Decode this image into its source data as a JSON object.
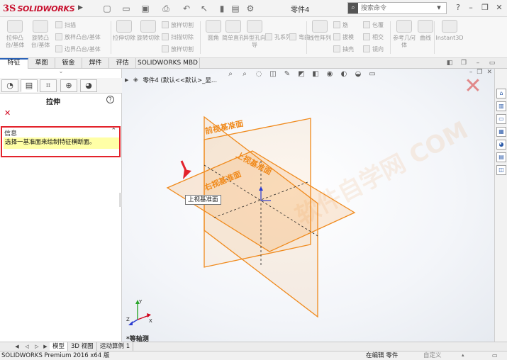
{
  "app": {
    "brand_ds": "3S",
    "brand_name": "SOLIDWORKS",
    "doc_title": "零件4",
    "search_placeholder": "搜索命令"
  },
  "ribbon": {
    "big": [
      {
        "label": "拉伸凸台/基体"
      },
      {
        "label": "旋转凸台/基体"
      },
      {
        "label": "拉伸切除"
      },
      {
        "label": "旋转切除"
      },
      {
        "label": "圆角"
      },
      {
        "label": "简单直孔"
      },
      {
        "label": "异型孔向导"
      },
      {
        "label": "线性阵列"
      },
      {
        "label": "参考几何体"
      },
      {
        "label": "曲线"
      },
      {
        "label": "Instant3D"
      }
    ],
    "small": [
      {
        "label": "扫描"
      },
      {
        "label": "放样凸台/基体"
      },
      {
        "label": "边界凸台/基体"
      },
      {
        "label": "放样切割"
      },
      {
        "label": "扫描切除"
      },
      {
        "label": "放样切割"
      },
      {
        "label": "孔系列"
      },
      {
        "label": "弯曲"
      },
      {
        "label": "筋"
      },
      {
        "label": "拔模"
      },
      {
        "label": "抽壳"
      },
      {
        "label": "包覆"
      },
      {
        "label": "相交"
      },
      {
        "label": "镜向"
      }
    ]
  },
  "tabs": [
    {
      "label": "特征"
    },
    {
      "label": "草图"
    },
    {
      "label": "钣金"
    },
    {
      "label": "焊件"
    },
    {
      "label": "评估"
    },
    {
      "label": "SOLIDWORKS MBD"
    }
  ],
  "property_manager": {
    "title": "拉伸",
    "info_header": "信息",
    "info_text": "选择一基准面来绘制特征横断面。"
  },
  "viewport": {
    "tree_text": "零件4  (默认<<默认>_显...",
    "plane_front": "前视基准面",
    "plane_top": "上视基准面",
    "plane_right": "右视基准面",
    "tooltip": "上视基准面",
    "view_name": "*等轴测",
    "triad_x": "X",
    "triad_y": "Y",
    "triad_z": "Z"
  },
  "model_tabs": [
    {
      "label": "模型"
    },
    {
      "label": "3D 视图"
    },
    {
      "label": "运动算例 1"
    }
  ],
  "status": {
    "app_version": "SOLIDWORKS Premium 2016 x64 版",
    "edit_state": "在编辑 零件",
    "custom": "自定义"
  },
  "colors": {
    "plane": "#f08a1c",
    "highlight_box": "#e3232c",
    "info_bg": "#ffffa6",
    "arrow": "#e3232c"
  }
}
